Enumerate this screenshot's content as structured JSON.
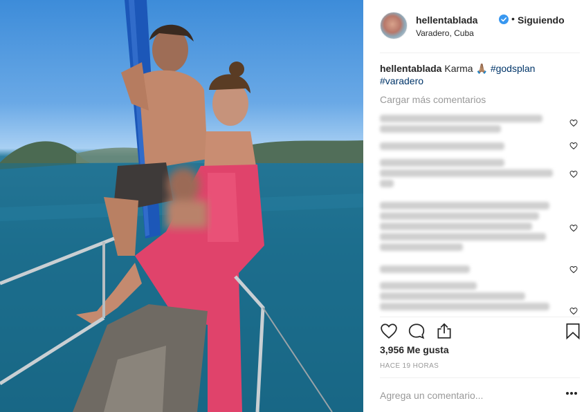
{
  "post": {
    "username": "hellentablada",
    "follow_status": "Siguiendo",
    "location": "Varadero, Cuba",
    "caption": {
      "text": "Karma 🙏🏽",
      "hashtags": [
        "#godsplan",
        "#varadero"
      ]
    },
    "load_more_comments": "Cargar más comentarios",
    "likes": "3,956 Me gusta",
    "time_ago": "HACE 19 HORAS",
    "add_comment_placeholder": "Agrega un comentario..."
  },
  "icons": {
    "verified": "verified-badge-icon",
    "like": "heart-icon",
    "comment": "comment-bubble-icon",
    "share": "share-icon",
    "save": "bookmark-icon",
    "more": "more-options-icon"
  },
  "colors": {
    "verified_badge": "#3897f0",
    "hashtag": "#003569",
    "muted": "#999999"
  }
}
